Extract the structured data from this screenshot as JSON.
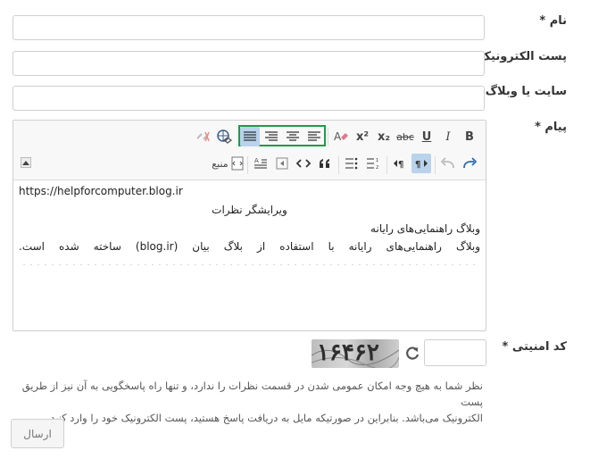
{
  "form": {
    "name_label": "نام *",
    "email_label": "پست الکترونیک",
    "website_label": "سایت یا وبلاگ",
    "message_label": "پیام *",
    "captcha_label": "کد امنیتی *",
    "captcha_text": "۱۶۴۶۲",
    "notice_line1": "نظر شما به هیچ وجه امکان عمومی شدن در قسمت نظرات را ندارد، و تنها راه پاسخگویی به آن نیز از طریق پست",
    "notice_line2": "الکترونیک می‌باشد. بنابراین در صورتیکه مایل به دریافت پاسخ هستید، پست الکترونیک خود را وارد کنید.",
    "submit_label": "ارسال"
  },
  "toolbar": {
    "bold": "B",
    "italic": "I",
    "underline": "U",
    "strike": "abc",
    "subscript": "x₂",
    "superscript": "x²",
    "source_label": "منبع"
  },
  "editor": {
    "line1": "https://helpforcomputer.blog.ir",
    "line2": "ویرایشگر نظرات",
    "line3": "وبلاگ راهنمایی‌های رایانه",
    "line4": "وبلاگ راهنمایی‌های رایانه با استفاده از بلاگ بیان (blog.ir) ساخته شده است."
  }
}
